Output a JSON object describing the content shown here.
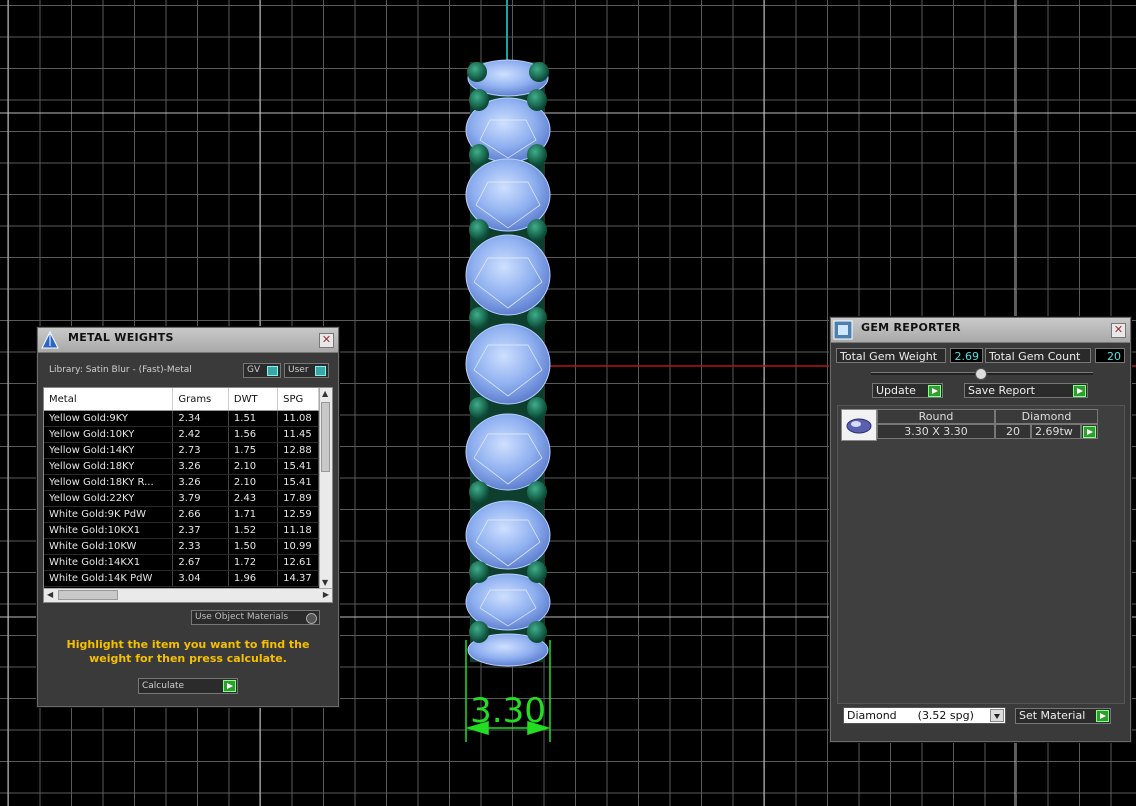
{
  "viewport": {
    "dimension_label": "3.30"
  },
  "metal_weights": {
    "title": "METAL WEIGHTS",
    "library_label": "Library: Satin Blur - (Fast)-Metal",
    "gv_label": "GV",
    "user_label": "User",
    "columns": [
      "Metal",
      "Grams",
      "DWT",
      "SPG"
    ],
    "rows": [
      [
        "Yellow Gold:9KY",
        "2.34",
        "1.51",
        "11.08"
      ],
      [
        "Yellow Gold:10KY",
        "2.42",
        "1.56",
        "11.45"
      ],
      [
        "Yellow Gold:14KY",
        "2.73",
        "1.75",
        "12.88"
      ],
      [
        "Yellow Gold:18KY",
        "3.26",
        "2.10",
        "15.41"
      ],
      [
        "Yellow Gold:18KY R...",
        "3.26",
        "2.10",
        "15.41"
      ],
      [
        "Yellow Gold:22KY",
        "3.79",
        "2.43",
        "17.89"
      ],
      [
        "White Gold:9K PdW",
        "2.66",
        "1.71",
        "12.59"
      ],
      [
        "White Gold:10KX1",
        "2.37",
        "1.52",
        "11.18"
      ],
      [
        "White Gold:10KW",
        "2.33",
        "1.50",
        "10.99"
      ],
      [
        "White Gold:14KX1",
        "2.67",
        "1.72",
        "12.61"
      ],
      [
        "White Gold:14K PdW",
        "3.04",
        "1.96",
        "14.37"
      ]
    ],
    "use_object_materials": "Use Object Materials",
    "hint": "Highlight the item you want to find the weight for then press calculate.",
    "calculate_label": "Calculate"
  },
  "gem_reporter": {
    "title": "GEM REPORTER",
    "total_weight_label": "Total Gem Weight",
    "total_weight_value": "2.69",
    "total_count_label": "Total Gem Count",
    "total_count_value": "20",
    "update_label": "Update",
    "save_report_label": "Save Report",
    "gem_header_shape": "Round",
    "gem_header_material": "Diamond",
    "gem_size": "3.30 X 3.30",
    "gem_count": "20",
    "gem_weight": "2.69tw",
    "material_select": "Diamond      (3.52 spg)",
    "set_material_label": "Set Material"
  }
}
